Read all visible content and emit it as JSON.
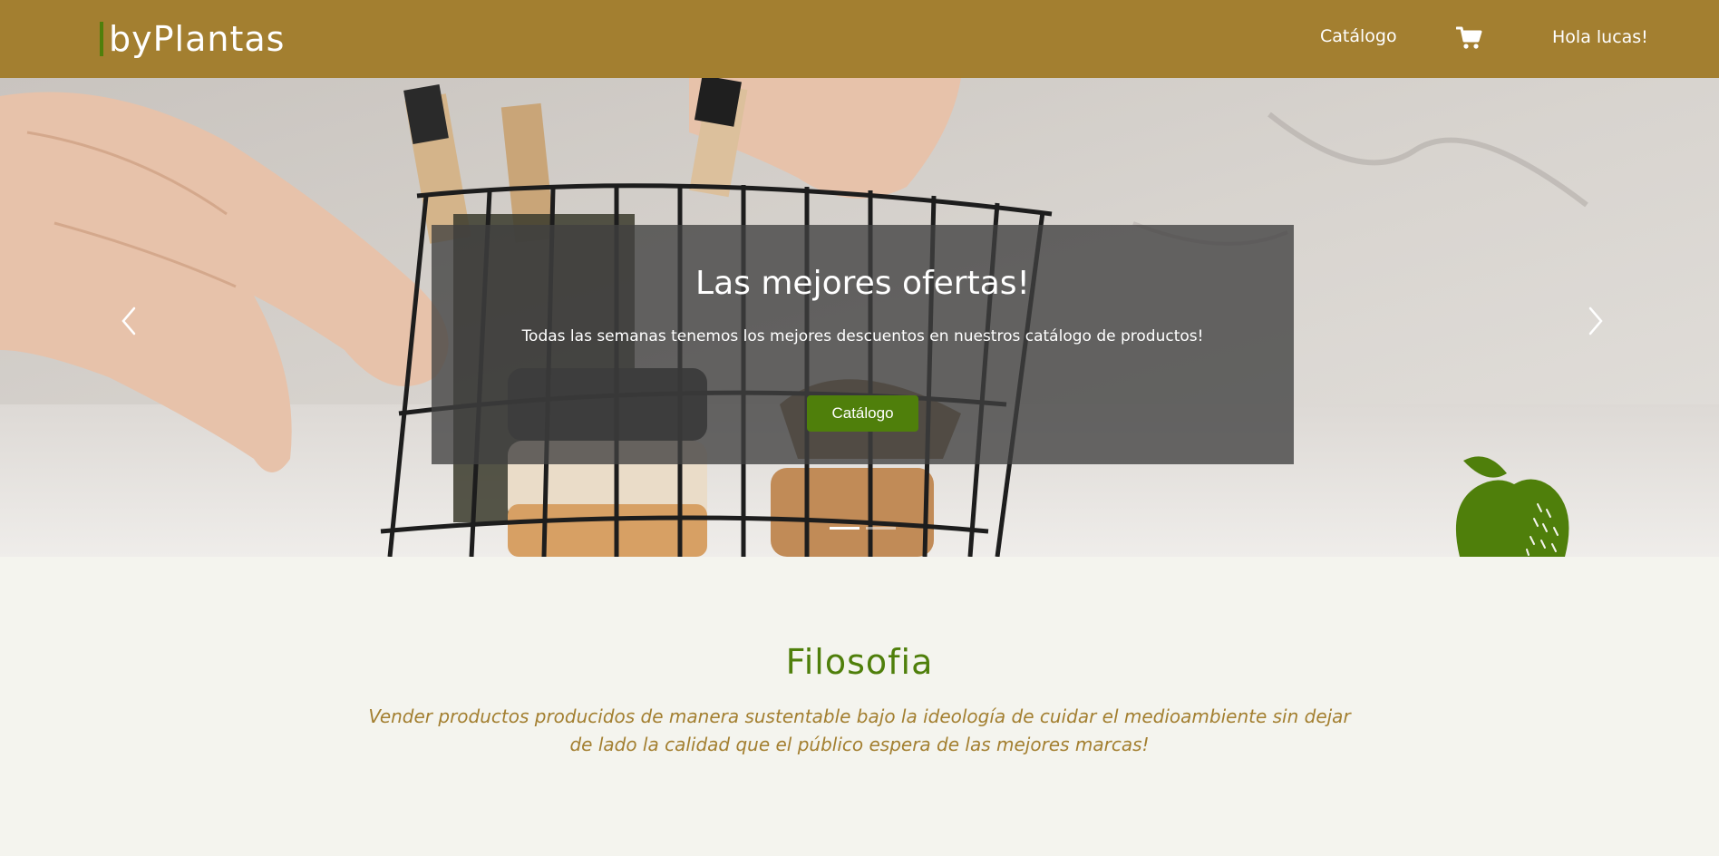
{
  "header": {
    "brand": "byPlantas",
    "nav_catalog": "Catálogo",
    "cart_icon": "shopping-cart-icon",
    "user_greeting": "Hola lucas!"
  },
  "hero": {
    "title": "Las mejores ofertas!",
    "text": "Todas las semanas tenemos los mejores descuentos en nuestros catálogo de productos!",
    "button_label": "Catálogo",
    "slide_count": 2,
    "active_slide": 1,
    "prev_icon": "chevron-left-icon",
    "next_icon": "chevron-right-icon",
    "decoration_icon": "apple-icon"
  },
  "philosophy": {
    "title": "Filosofia",
    "text": "Vender productos producidos de manera sustentable bajo la ideología de cuidar el medioambiente sin dejar de lado la calidad que el público espera de las mejores marcas!"
  },
  "colors": {
    "header_bg": "#a37f30",
    "accent_green": "#4f7f0b",
    "page_bg": "#f4f4ee",
    "philosophy_text": "#a37f30"
  }
}
